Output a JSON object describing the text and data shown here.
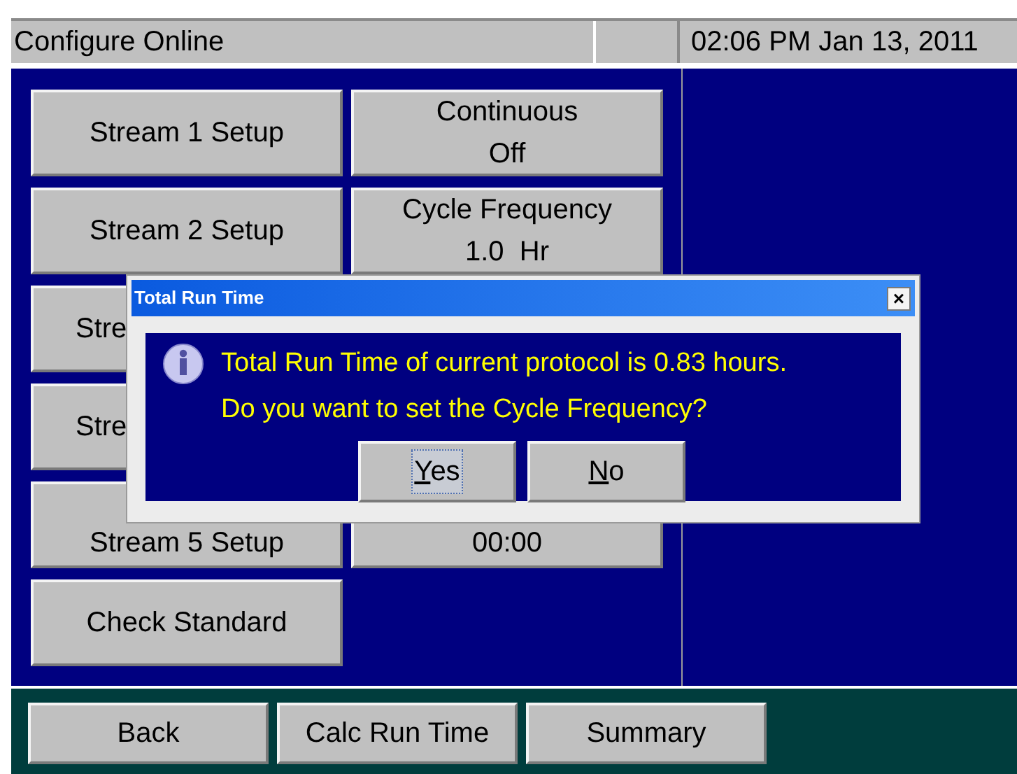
{
  "title_bar": {
    "title": "Configure Online",
    "datetime": "02:06 PM Jan 13, 2011"
  },
  "left_buttons": [
    {
      "label": [
        "Stream 1 Setup"
      ]
    },
    {
      "label": [
        "Stream 2 Setup"
      ]
    },
    {
      "label": [
        "Stre"
      ]
    },
    {
      "label": [
        "Stre"
      ]
    },
    {
      "label": [
        "Stream 5 Setup"
      ]
    },
    {
      "label": [
        "Check Standard"
      ]
    }
  ],
  "right_buttons": [
    {
      "label": [
        "Continuous",
        "Off"
      ]
    },
    {
      "label": [
        "Cycle Frequency",
        "1.0  Hr"
      ]
    },
    {
      "label": [
        "00:00"
      ]
    }
  ],
  "bottom_buttons": [
    "Back",
    "Calc Run Time",
    "Summary"
  ],
  "dialog": {
    "title": "Total Run Time",
    "close": "×",
    "message": [
      "Total Run Time of current protocol is 0.83 hours.",
      "Do you want to set the Cycle Frequency?"
    ],
    "buttons": [
      {
        "label": "Yes",
        "focused": true
      },
      {
        "label": "No",
        "focused": false
      }
    ]
  }
}
